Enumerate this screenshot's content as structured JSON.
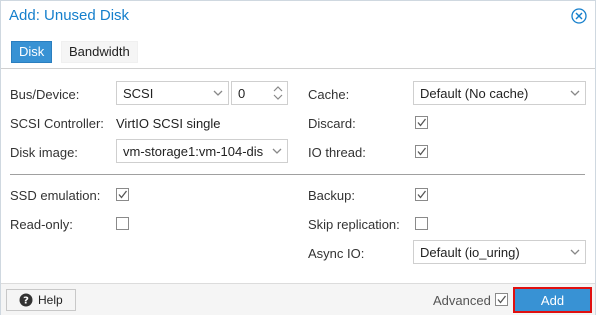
{
  "dialog": {
    "title": "Add: Unused Disk"
  },
  "tabs": [
    {
      "label": "Disk",
      "active": true
    },
    {
      "label": "Bandwidth",
      "active": false
    }
  ],
  "form": {
    "bus_device": {
      "label": "Bus/Device:",
      "bus": "SCSI",
      "device": "0"
    },
    "scsi_controller": {
      "label": "SCSI Controller:",
      "value": "VirtIO SCSI single"
    },
    "disk_image": {
      "label": "Disk image:",
      "value": "vm-storage1:vm-104-dis"
    },
    "cache": {
      "label": "Cache:",
      "value": "Default (No cache)"
    },
    "discard": {
      "label": "Discard:",
      "checked": true
    },
    "io_thread": {
      "label": "IO thread:",
      "checked": true
    },
    "ssd_emulation": {
      "label": "SSD emulation:",
      "checked": true
    },
    "read_only": {
      "label": "Read-only:",
      "checked": false
    },
    "backup": {
      "label": "Backup:",
      "checked": true
    },
    "skip_replication": {
      "label": "Skip replication:",
      "checked": false
    },
    "async_io": {
      "label": "Async IO:",
      "value": "Default (io_uring)"
    }
  },
  "footer": {
    "help_label": "Help",
    "advanced_label": "Advanced",
    "advanced_checked": true,
    "add_label": "Add"
  },
  "colors": {
    "accent": "#3892d4",
    "title": "#157fcc",
    "highlight_border": "#e01010"
  }
}
